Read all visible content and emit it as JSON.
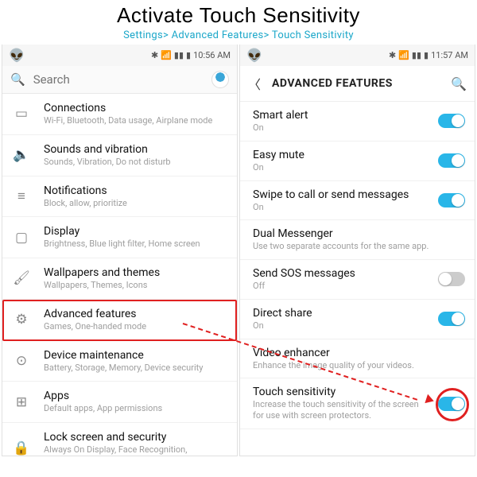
{
  "header": {
    "title": "Activate Touch Sensitivity",
    "breadcrumb": "Settings> Advanced Features> Touch Sensitivity"
  },
  "left": {
    "time": "10:56 AM",
    "search_placeholder": "Search",
    "items": [
      {
        "icon": "▭",
        "label": "Connections",
        "sub": "Wi-Fi, Bluetooth, Data usage, Airplane mode"
      },
      {
        "icon": "🔈",
        "label": "Sounds and vibration",
        "sub": "Sounds, Vibration, Do not disturb"
      },
      {
        "icon": "≡",
        "label": "Notifications",
        "sub": "Block, allow, prioritize"
      },
      {
        "icon": "▢",
        "label": "Display",
        "sub": "Brightness, Blue light filter, Home screen"
      },
      {
        "icon": "🖌",
        "label": "Wallpapers and themes",
        "sub": "Wallpapers, Themes, Icons"
      },
      {
        "icon": "⚙",
        "label": "Advanced features",
        "sub": "Games, One-handed mode"
      },
      {
        "icon": "⊙",
        "label": "Device maintenance",
        "sub": "Battery, Storage, Memory, Device security"
      },
      {
        "icon": "⊞",
        "label": "Apps",
        "sub": "Default apps, App permissions"
      },
      {
        "icon": "🔒",
        "label": "Lock screen and security",
        "sub": "Always On Display, Face Recognition, Fingerprints, Iris"
      }
    ]
  },
  "right": {
    "time": "11:57 AM",
    "title": "ADVANCED FEATURES",
    "items": [
      {
        "label": "Smart alert",
        "sub": "On",
        "toggle": "on"
      },
      {
        "label": "Easy mute",
        "sub": "On",
        "toggle": "on"
      },
      {
        "label": "Swipe to call or send messages",
        "sub": "On",
        "toggle": "on"
      },
      {
        "label": "Dual Messenger",
        "sub": "Use two separate accounts for the same app.",
        "toggle": ""
      },
      {
        "label": "Send SOS messages",
        "sub": "Off",
        "toggle": "off"
      },
      {
        "label": "Direct share",
        "sub": "On",
        "toggle": "on"
      },
      {
        "label": "Video enhancer",
        "sub": "Enhance the image quality of your videos.",
        "toggle": ""
      },
      {
        "label": "Touch sensitivity",
        "sub": "Increase the touch sensitivity of the screen for use with screen protectors.",
        "toggle": "on"
      }
    ]
  }
}
